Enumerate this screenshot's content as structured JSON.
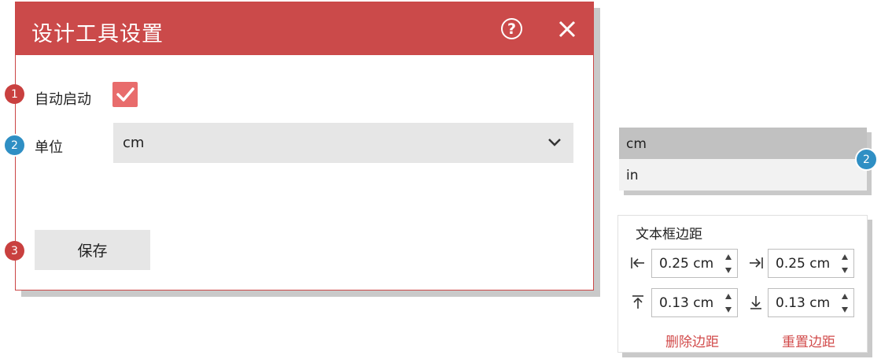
{
  "dialog": {
    "title": "设计工具设置",
    "help_label": "?",
    "autostart_label": "自动启动",
    "autostart_checked": true,
    "unit_label": "单位",
    "unit_value": "cm",
    "save_label": "保存"
  },
  "badges": {
    "b1": "1",
    "b2": "2",
    "b3": "3",
    "b4": "2"
  },
  "unit_dropdown": {
    "options": [
      "cm",
      "in"
    ],
    "selected": "cm"
  },
  "margins": {
    "title": "文本框边距",
    "left": "0.25 cm",
    "right": "0.25 cm",
    "top": "0.13 cm",
    "bottom": "0.13 cm",
    "delete_label": "删除边距",
    "reset_label": "重置边距"
  },
  "colors": {
    "accent": "#cb4a4a",
    "checkbox": "#e86c6c",
    "badge_red": "#c9403f",
    "badge_blue": "#2f8fc4",
    "link": "#d24b4b"
  }
}
